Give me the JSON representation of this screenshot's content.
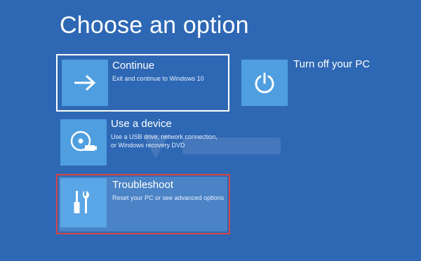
{
  "title": "Choose an option",
  "options": {
    "continue": {
      "title": "Continue",
      "description": "Exit and continue to Windows 10",
      "icon": "arrow-right-icon"
    },
    "device": {
      "title": "Use a device",
      "description_line1": "Use a USB drive, network connection,",
      "description_line2": "or Windows recovery DVD",
      "icon": "disc-usb-icon"
    },
    "troubleshoot": {
      "title": "Troubleshoot",
      "description": "Reset your PC or see advanced options",
      "icon": "tools-icon"
    },
    "turnoff": {
      "title": "Turn off your PC",
      "icon": "power-icon"
    }
  },
  "colors": {
    "background": "#2e68b4",
    "tile": "#4f9ee0",
    "selection_border": "#ffffff",
    "highlight_border": "#d64545"
  }
}
